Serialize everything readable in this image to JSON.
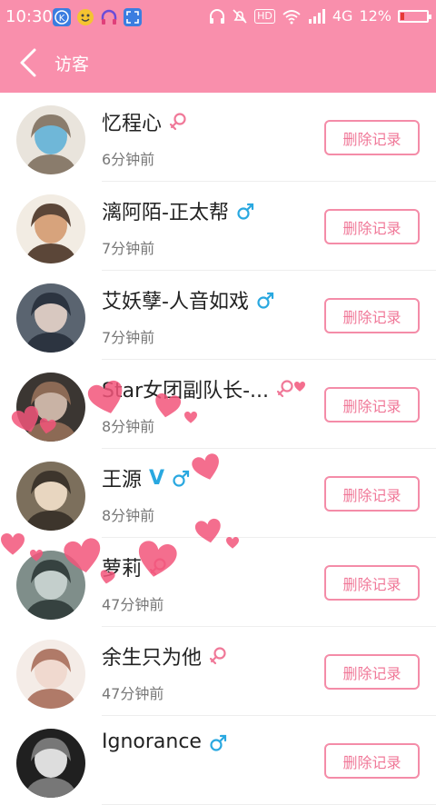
{
  "statusbar": {
    "time": "10:30",
    "hd": "HD",
    "network": "4G",
    "battery": "12%",
    "battery_level": 0.12,
    "notification_icons": [
      "k-app-icon",
      "game-face-icon",
      "headset-icon",
      "scan-icon"
    ]
  },
  "header": {
    "title": "访客"
  },
  "colors": {
    "accent": "#f98fac",
    "button_border": "#f48ca8",
    "male": "#29a8e0",
    "female": "#f07898"
  },
  "visitors": [
    {
      "name": "忆程心",
      "gender": "female",
      "time": "6分钟前",
      "button": "删除记录"
    },
    {
      "name": "漓阿陌-正太帮",
      "gender": "male",
      "time": "7分钟前",
      "button": "删除记录"
    },
    {
      "name": "艾妖孽-人音如戏",
      "gender": "male",
      "time": "7分钟前",
      "button": "删除记录"
    },
    {
      "name": "Star女团副队长-...",
      "gender": "female",
      "time": "8分钟前",
      "button": "删除记录"
    },
    {
      "name": "王源",
      "gender": "male",
      "verified": "V",
      "time": "8分钟前",
      "button": "删除记录"
    },
    {
      "name": "萝莉",
      "gender": "female",
      "time": "47分钟前",
      "button": "删除记录"
    },
    {
      "name": "余生只为他",
      "gender": "female",
      "time": "47分钟前",
      "button": "删除记录"
    },
    {
      "name": "Ignorance",
      "gender": "male",
      "time": "",
      "button": "删除记录"
    }
  ]
}
